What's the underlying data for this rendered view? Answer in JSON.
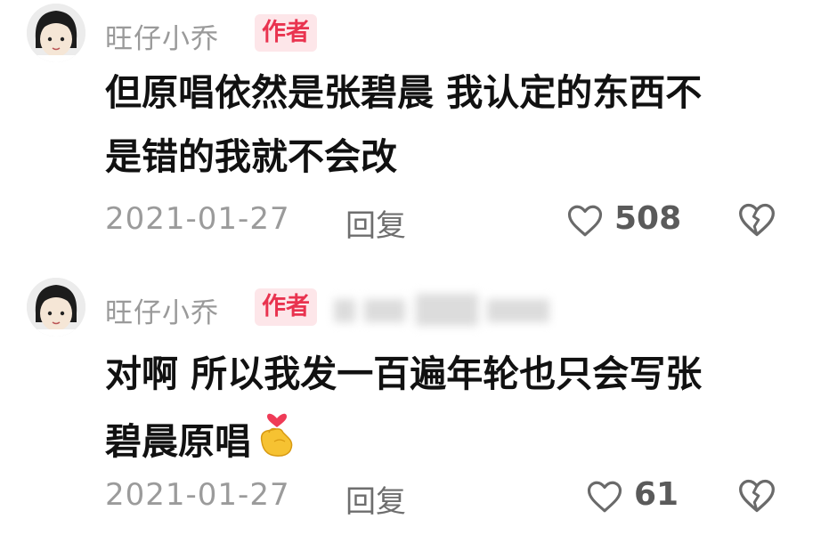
{
  "comments": [
    {
      "username": "旺仔小乔",
      "badge": "作者",
      "lines": [
        "但原唱依然是张碧晨 我认定的东西不",
        "是错的我就不会改"
      ],
      "date": "2021-01-27",
      "reply": "回复",
      "likes": "508",
      "icons": {
        "like": "heart-outline-icon",
        "dislike": "broken-heart-icon"
      }
    },
    {
      "username": "旺仔小乔",
      "badge": "作者",
      "lines": [
        "对啊 所以我发一百遍年轮也只会写张",
        "碧晨原唱"
      ],
      "emoji": "finger-heart-emoji",
      "date": "2021-01-27",
      "reply": "回复",
      "likes": "61",
      "icons": {
        "like": "heart-outline-icon",
        "dislike": "broken-heart-icon"
      }
    }
  ],
  "colors": {
    "badge_bg": "#fde6e9",
    "badge_text": "#e9334f",
    "meta_text": "#9b9b9b",
    "body_text": "#111111"
  }
}
